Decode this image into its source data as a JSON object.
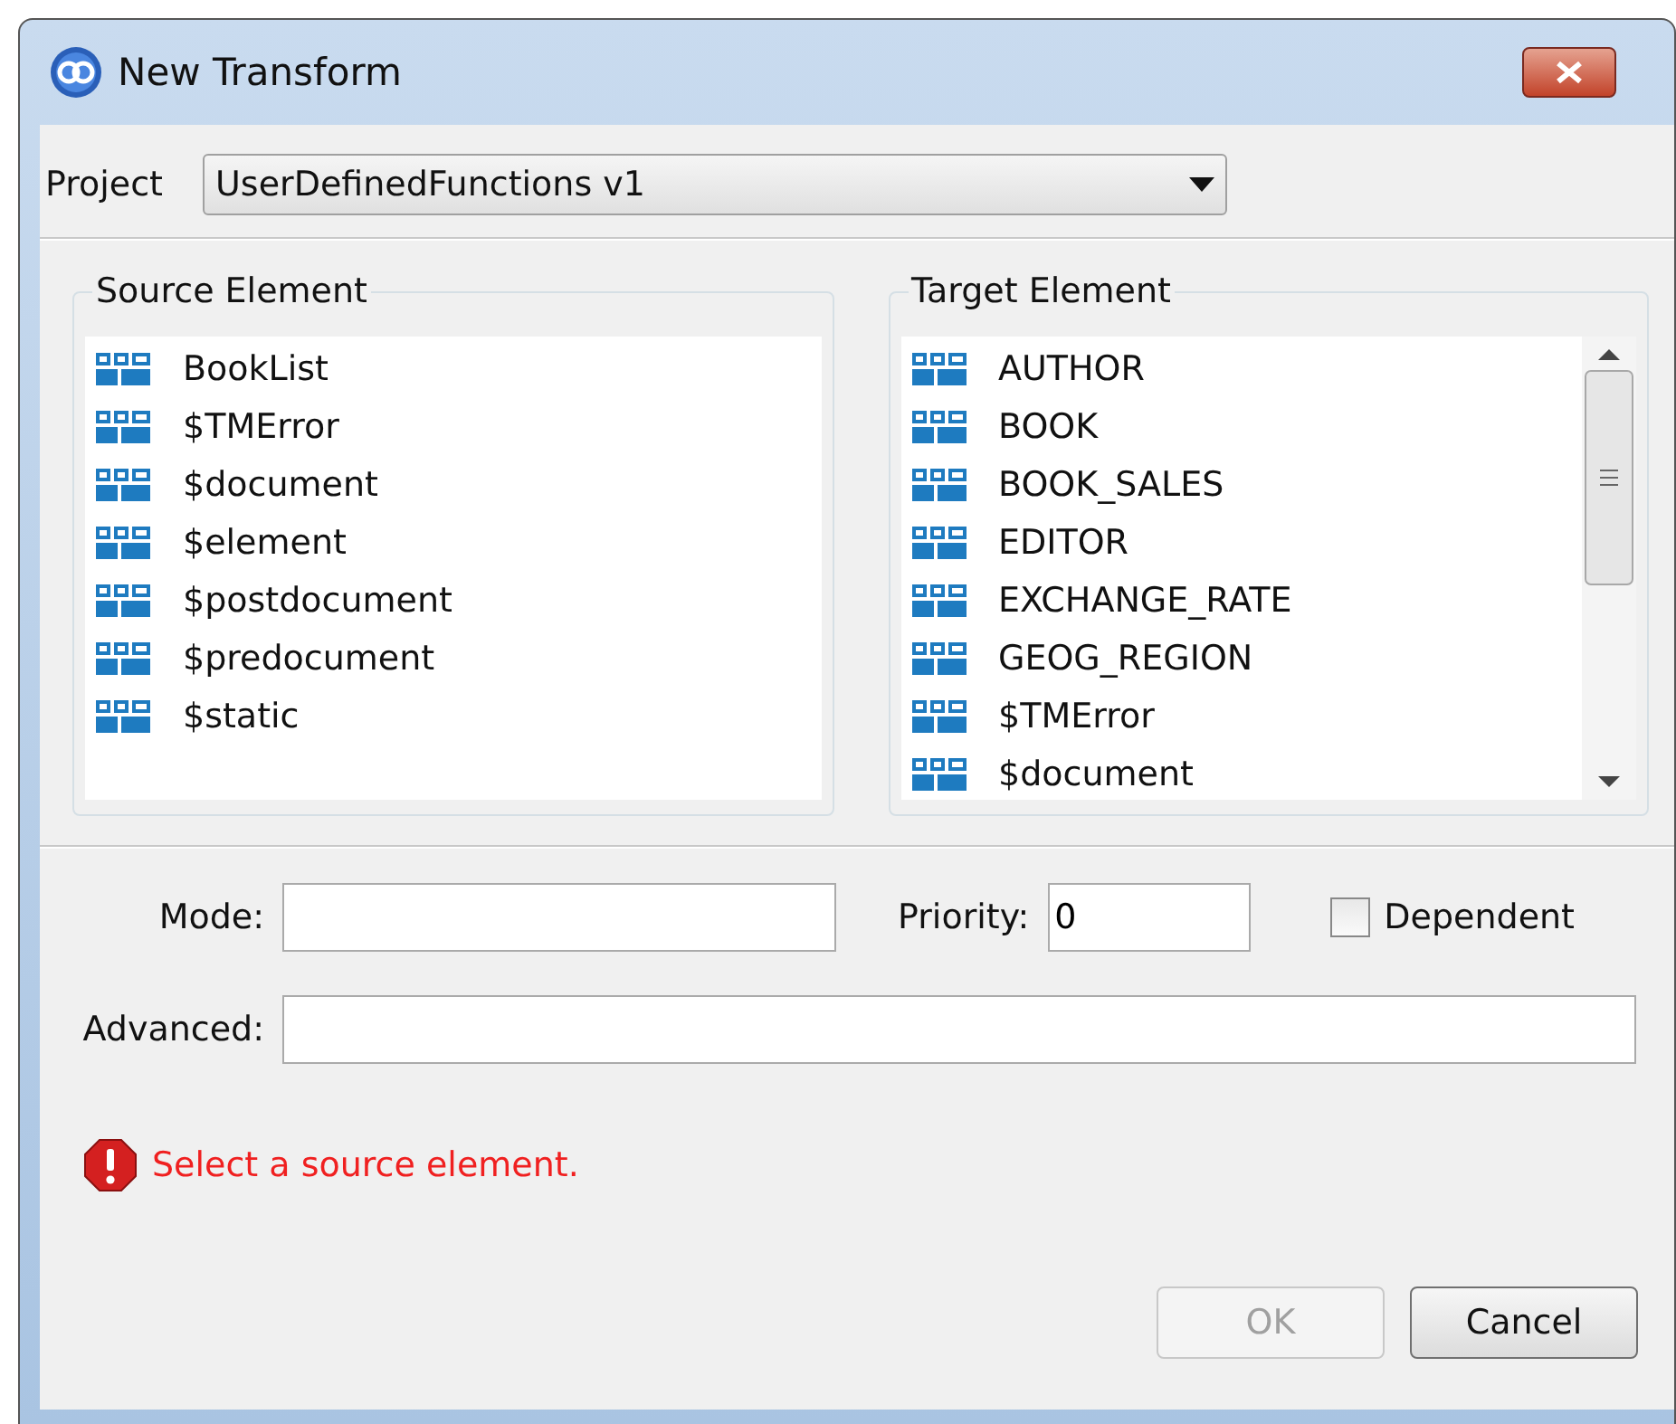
{
  "window": {
    "title": "New Transform"
  },
  "project": {
    "label": "Project",
    "value": "UserDefinedFunctions v1"
  },
  "source_element": {
    "title": "Source Element",
    "items": [
      "BookList",
      "$TMError",
      "$document",
      "$element",
      "$postdocument",
      "$predocument",
      "$static"
    ]
  },
  "target_element": {
    "title": "Target Element",
    "items": [
      "AUTHOR",
      "BOOK",
      "BOOK_SALES",
      "EDITOR",
      "EXCHANGE_RATE",
      "GEOG_REGION",
      "$TMError",
      "$document"
    ]
  },
  "mode": {
    "label": "Mode:"
  },
  "priority": {
    "label": "Priority:",
    "value": "0"
  },
  "dependent": {
    "label": "Dependent",
    "checked": false
  },
  "advanced": {
    "label": "Advanced:"
  },
  "error": {
    "message": "Select a source element."
  },
  "buttons": [
    {
      "label": "OK",
      "disabled": true
    },
    {
      "label": "Cancel",
      "disabled": false
    }
  ]
}
